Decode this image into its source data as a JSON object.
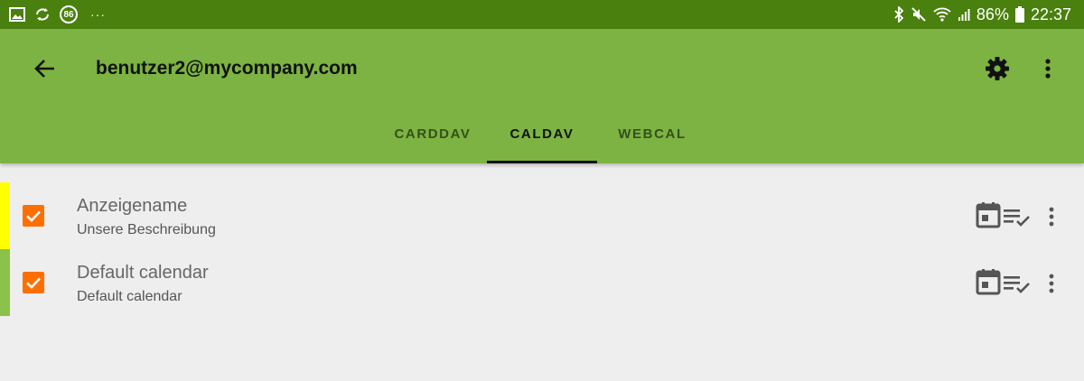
{
  "status_bar": {
    "notification_badge": "86",
    "more": "···",
    "battery": "86%",
    "time": "22:37",
    "icons": [
      "image-icon",
      "sync-icon",
      "bluetooth-icon",
      "mute-icon",
      "wifi-icon",
      "signal-icon",
      "battery-icon"
    ]
  },
  "app_bar": {
    "title": "benutzer2@mycompany.com",
    "icons": [
      "back-arrow-icon",
      "settings-gear-icon",
      "overflow-menu-icon"
    ]
  },
  "tabs": [
    {
      "label": "CARDDAV",
      "active": false
    },
    {
      "label": "CALDAV",
      "active": true
    },
    {
      "label": "WEBCAL",
      "active": false
    }
  ],
  "calendars": [
    {
      "name": "Anzeigename",
      "description": "Unsere Beschreibung",
      "color": "#ffff00",
      "checked": true
    },
    {
      "name": "Default calendar",
      "description": "Default calendar",
      "color": "#8bc34a",
      "checked": true
    }
  ],
  "colors": {
    "status_bar": "#4a800e",
    "app_bar": "#7cb342",
    "checkbox": "#ff6f00",
    "background": "#eeeeee"
  }
}
